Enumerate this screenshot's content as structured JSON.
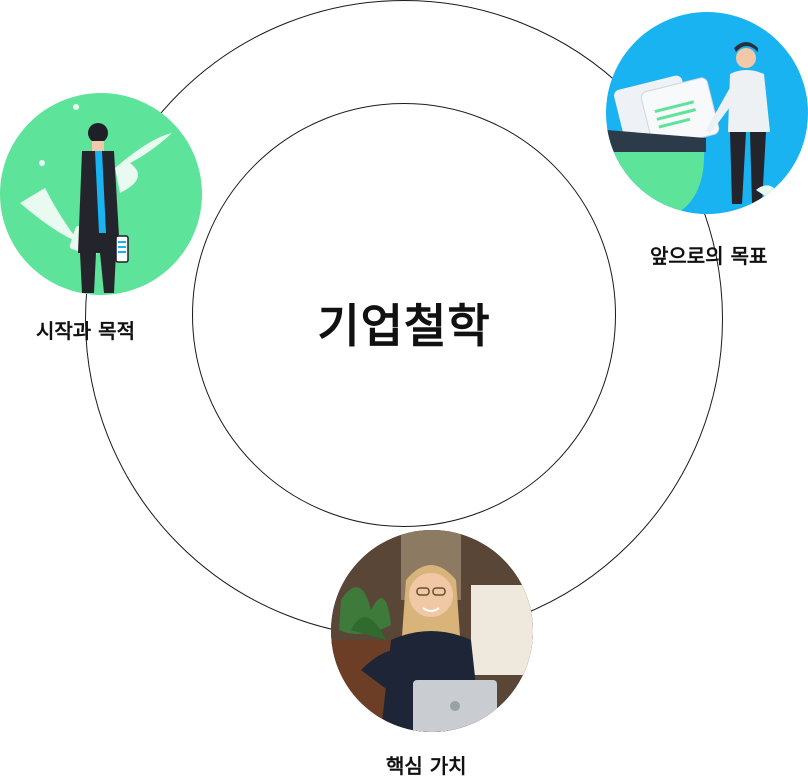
{
  "title": "기업철학",
  "nodes": [
    {
      "id": "start",
      "label": "시작과 목적",
      "color": "#5ee39b",
      "image": "person-standing-phone-icon"
    },
    {
      "id": "goal",
      "label": "앞으로의 목표",
      "color": "#19b3f2",
      "image": "person-with-documents-icon"
    },
    {
      "id": "value",
      "label": "핵심 가치",
      "color": "#3a2e26",
      "image": "woman-on-phone-laptop-photo"
    }
  ]
}
